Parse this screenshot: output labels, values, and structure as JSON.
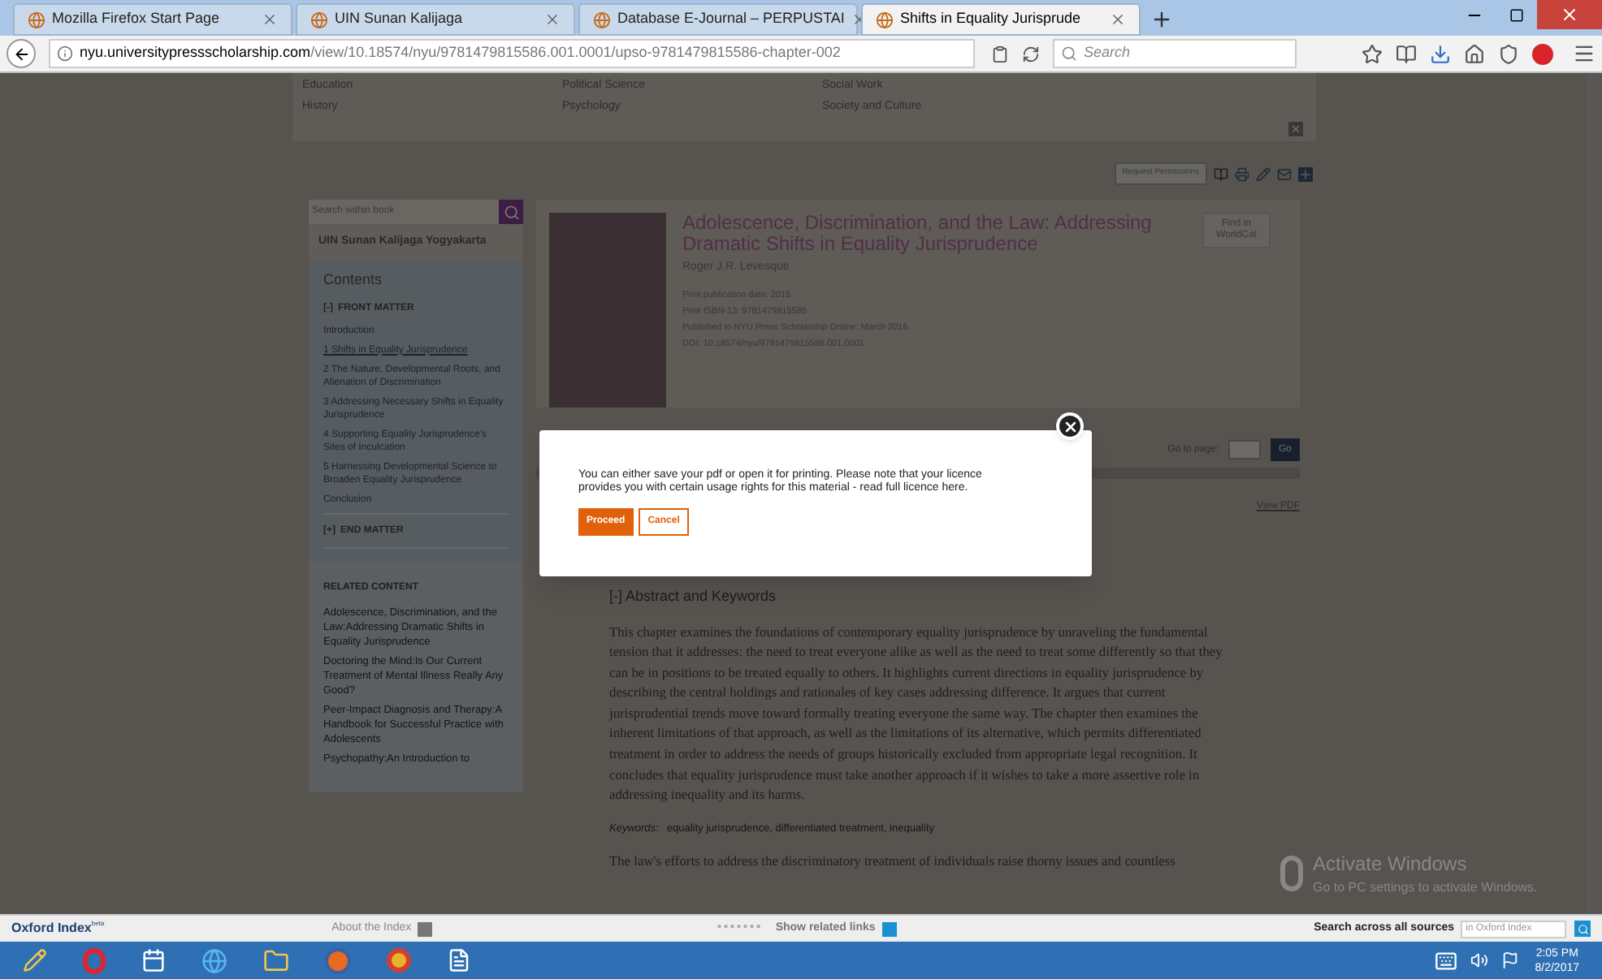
{
  "browser": {
    "tabs": [
      {
        "label": "Mozilla Firefox Start Page",
        "selected": false
      },
      {
        "label": "UIN Sunan Kalijaga",
        "selected": false
      },
      {
        "label": "Database E-Journal – PERPUSTAI",
        "selected": false
      },
      {
        "label": "Shifts in Equality Jurisprude",
        "selected": true
      }
    ],
    "url_host": "nyu.universitypressscholarship.com",
    "url_path": "/view/10.18574/nyu/9781479815586.001.0001/upso-9781479815586-chapter-002",
    "search_placeholder": "Search"
  },
  "subjects": [
    [
      "Education",
      "History"
    ],
    [
      "Political Science",
      "Psychology"
    ],
    [
      "Social Work",
      "Society and Culture"
    ]
  ],
  "toolbar": {
    "request_button": "Request Permissions"
  },
  "sidebar": {
    "search_placeholder": "Search within book",
    "institution": "UIN Sunan Kalijaga Yogyakarta",
    "contents_title": "Contents",
    "sections": [
      {
        "toggle": "[-]",
        "label": "FRONT MATTER",
        "children": [
          {
            "label": "Introduction",
            "selected": false
          },
          {
            "label": "1 Shifts in Equality Jurisprudence",
            "selected": true
          },
          {
            "label": "2 The Nature, Developmental Roots, and Alienation of Discrimination",
            "selected": false
          },
          {
            "label": "3 Addressing Necessary Shifts in Equality Jurisprudence",
            "selected": false
          },
          {
            "label": "4 Supporting Equality Jurisprudence's Sites of Inculcation",
            "selected": false
          },
          {
            "label": "5 Harnessing Developmental Science to Broaden Equality Jurisprudence",
            "selected": false
          },
          {
            "label": "Conclusion",
            "selected": false
          }
        ]
      },
      {
        "toggle": "[+]",
        "label": "END MATTER"
      }
    ],
    "related_title": "RELATED CONTENT",
    "related": [
      "Adolescence, Discrimination, and the Law:Addressing Dramatic Shifts in Equality Jurisprudence",
      "Doctoring the Mind:Is Our Current Treatment of Mental Illness Really Any Good?",
      "Peer-Impact Diagnosis and Therapy:A Handbook for Successful Practice with Adolescents",
      "Psychopathy:An Introduction to"
    ]
  },
  "book": {
    "title": "Adolescence, Discrimination, and the Law: Addressing Dramatic Shifts in Equality Jurisprudence",
    "author": "Roger J.R. Levesque",
    "meta": [
      "Print publication date: 2015",
      "Print ISBN-13: 9781479815586",
      "Published to NYU Press Scholarship Online: March 2016",
      "DOI: 10.18574/nyu/9781479815586.001.0001"
    ],
    "worldcat": "Find in WorldCat"
  },
  "pager": {
    "label": "Go to page:",
    "button": "Go"
  },
  "view_pdf": "View PDF",
  "abstract": {
    "heading": "[-] Abstract and Keywords",
    "text": "This chapter examines the foundations of contemporary equality jurisprudence by unraveling the fundamental tension that it addresses: the need to treat everyone alike as well as the need to treat some differently so that they can be in positions to be treated equally to others. It highlights current directions in equality jurisprudence by describing the central holdings and rationales of key cases addressing difference. It argues that current jurisprudential trends move toward formally treating everyone the same way. The chapter then examines the inherent limitations of that approach, as well as the limitations of its alternative, which permits differentiated treatment in order to address the needs of groups historically excluded from appropriate legal recognition. It concludes that equality jurisprudence must take another approach if it wishes to take a more assertive role in addressing inequality and its harms.",
    "keywords_label": "Keywords:",
    "keywords": "equality jurisprudence, differentiated treatment, inequality",
    "next": "The law's efforts to address the discriminatory treatment of individuals raise thorny issues and countless"
  },
  "dialog": {
    "message": "You can either save your pdf or open it for printing. Please note that your licence provides you with certain usage rights for this material - read full licence here.",
    "proceed": "Proceed",
    "cancel": "Cancel"
  },
  "activation": {
    "title": "Activate Windows",
    "subtitle": "Go to PC settings to activate Windows."
  },
  "oxford_bar": {
    "logo": "Oxford Index",
    "beta": "beta",
    "about": "About the Index",
    "dots": "●●●●●●●",
    "related": "Show related links",
    "search_label": "Search across all sources",
    "search_placeholder": "in Oxford Index"
  },
  "taskbar": {
    "time": "2:05 PM",
    "date": "8/2/2017"
  }
}
